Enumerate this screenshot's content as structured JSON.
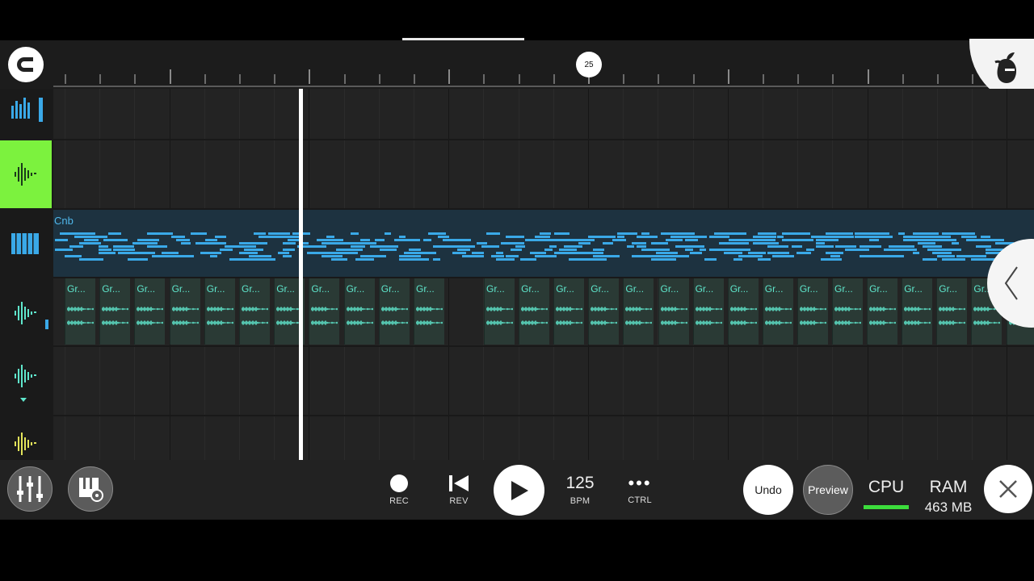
{
  "timeline": {
    "bar_marker": "25"
  },
  "tracks": [
    {
      "name": "pattern-track",
      "icon": "bar-graph-icon"
    },
    {
      "name": "audio-track-selected",
      "icon": "waveform-icon"
    },
    {
      "name": "piano-track",
      "icon": "piano-keys-icon"
    },
    {
      "name": "audio-track",
      "icon": "waveform-icon"
    },
    {
      "name": "audio-track",
      "icon": "waveform-icon"
    },
    {
      "name": "audio-track-yellow",
      "icon": "waveform-icon"
    }
  ],
  "clips": {
    "pattern_name": "Cnb",
    "audio_clip_label": "Gr...",
    "audio_clip_count": 27
  },
  "transport": {
    "rec_label": "REC",
    "rev_label": "REV",
    "bpm_value": "125",
    "bpm_label": "BPM",
    "ctrl_label": "CTRL",
    "ctrl_glyph": "•••"
  },
  "buttons": {
    "undo": "Undo",
    "preview": "Preview"
  },
  "status": {
    "cpu_label": "CPU",
    "ram_label": "RAM",
    "ram_value": "463 MB"
  },
  "colors": {
    "accent_green": "#7cf23e",
    "pattern_blue": "#3aa9e8",
    "audio_teal": "#5fe6cc",
    "cpu_bar": "#3cdd3c"
  }
}
